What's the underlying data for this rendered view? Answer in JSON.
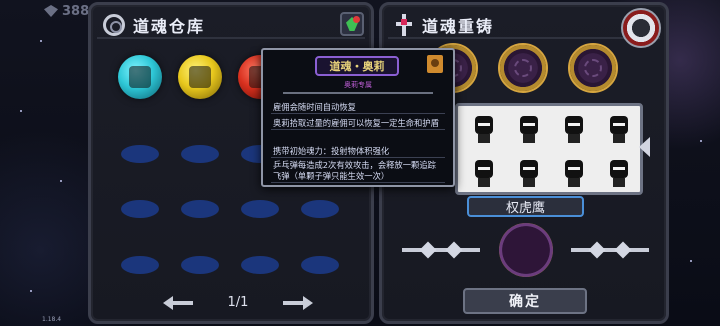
{
  "hud": {
    "gem_count": "388",
    "version": "1.18.4"
  },
  "left_panel": {
    "title": "道魂仓库",
    "orbs": [
      {
        "name": "cyan-orb",
        "color": "#2ec7d6"
      },
      {
        "name": "yellow-orb",
        "color": "#e8c81d"
      },
      {
        "name": "red-orb",
        "color": "#d8301e"
      }
    ],
    "pager": {
      "page": "1/1"
    }
  },
  "right_panel": {
    "title": "道魂重铸",
    "selected_name": "权虎鹰",
    "confirm_label": "确定"
  },
  "tooltip": {
    "title": "道魂・奥莉",
    "subtitle": "奥莉专属",
    "lines": [
      "雇佣会随时间自动恢复",
      "奥莉拾取过量的雇佣可以恢复一定生命和护盾",
      "携带初始魂力：投射物体积强化",
      "乒乓弹每造成2次有效攻击，会释放一颗追踪飞弹（单颗子弹只能生效一次）"
    ]
  },
  "colors": {
    "accent_blue": "#4a8fd8",
    "slot_blue": "#1c3a86",
    "gold": "#d6a640"
  }
}
